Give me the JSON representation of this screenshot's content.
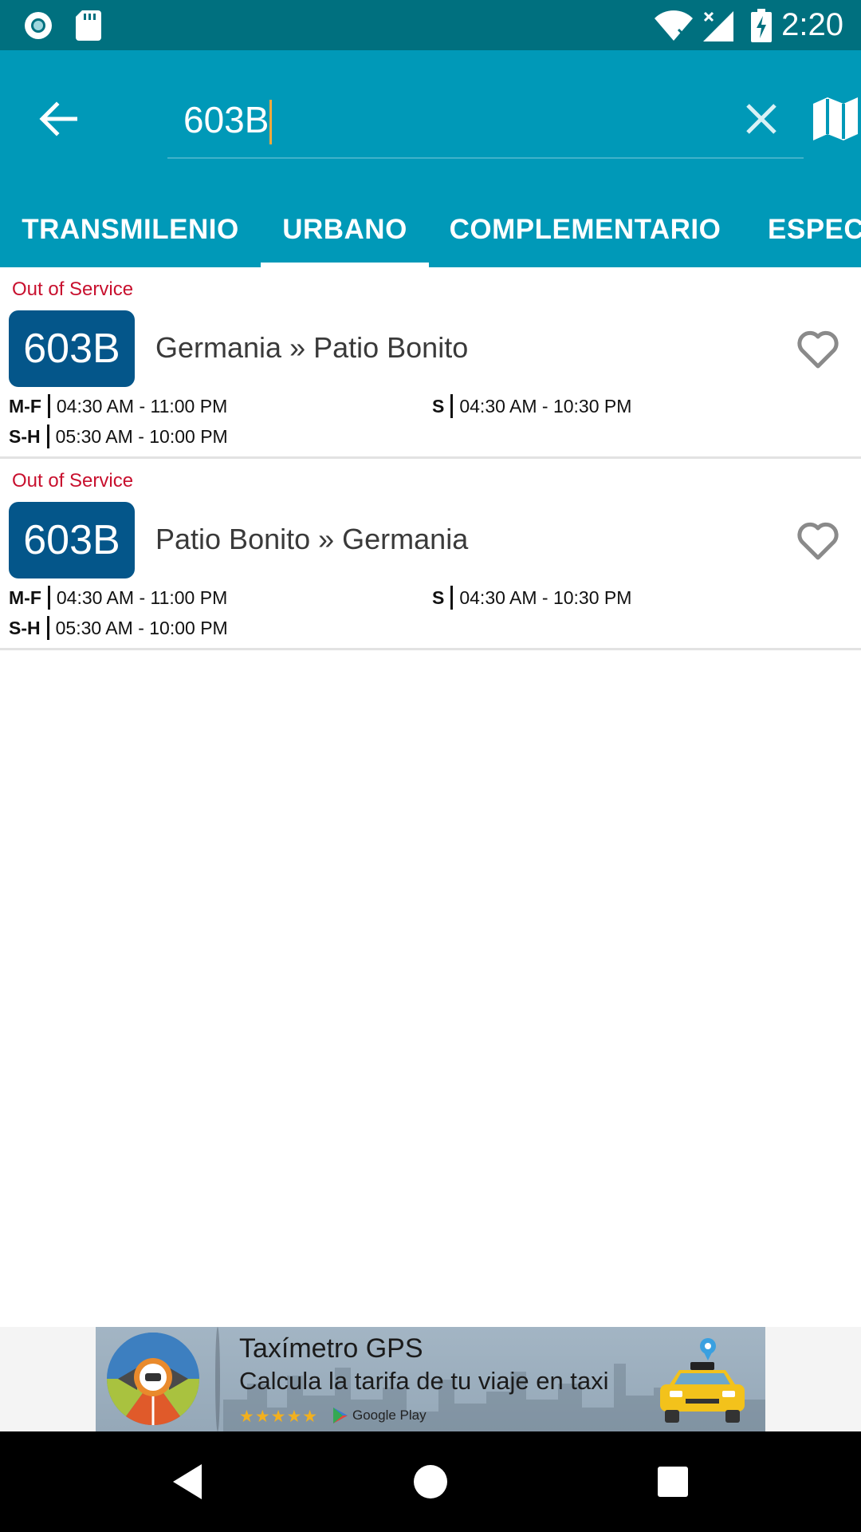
{
  "status_bar": {
    "time": "2:20",
    "icons": [
      "circle-notification-icon",
      "sd-card-icon",
      "wifi-icon",
      "signal-icon",
      "battery-charging-icon"
    ]
  },
  "app_bar": {
    "back_icon": "arrow-left-icon",
    "search": {
      "value": "603B",
      "placeholder": ""
    },
    "clear_icon": "close-icon",
    "map_icon": "map-icon"
  },
  "tabs": [
    {
      "label": "TRANSMILENIO",
      "selected": false
    },
    {
      "label": "URBANO",
      "selected": true
    },
    {
      "label": "COMPLEMENTARIO",
      "selected": false
    },
    {
      "label": "ESPECI",
      "selected": false
    }
  ],
  "routes": [
    {
      "status": "Out of Service",
      "code": "603B",
      "name": "Germania » Patio Bonito",
      "favorite": false,
      "schedule": [
        {
          "label": "M-F",
          "hours": "04:30 AM - 11:00 PM"
        },
        {
          "label": "S",
          "hours": "04:30 AM - 10:30 PM"
        },
        {
          "label": "S-H",
          "hours": "05:30 AM - 10:00 PM"
        }
      ]
    },
    {
      "status": "Out of Service",
      "code": "603B",
      "name": "Patio Bonito » Germania",
      "favorite": false,
      "schedule": [
        {
          "label": "M-F",
          "hours": "04:30 AM - 11:00 PM"
        },
        {
          "label": "S",
          "hours": "04:30 AM - 10:30 PM"
        },
        {
          "label": "S-H",
          "hours": "05:30 AM - 10:00 PM"
        }
      ]
    }
  ],
  "ad": {
    "title": "Taxímetro GPS",
    "subtitle": "Calcula la tarifa de tu viaje en taxi",
    "stars": "★★★★★",
    "store": "Google Play"
  },
  "colors": {
    "status_bar": "#00707f",
    "app_bar": "#0099b8",
    "badge": "#04568a",
    "status_text": "#c8102e",
    "caret": "#f6a93b"
  },
  "nav_bar": {
    "icons": [
      "back-triangle-icon",
      "home-circle-icon",
      "recents-square-icon"
    ]
  }
}
